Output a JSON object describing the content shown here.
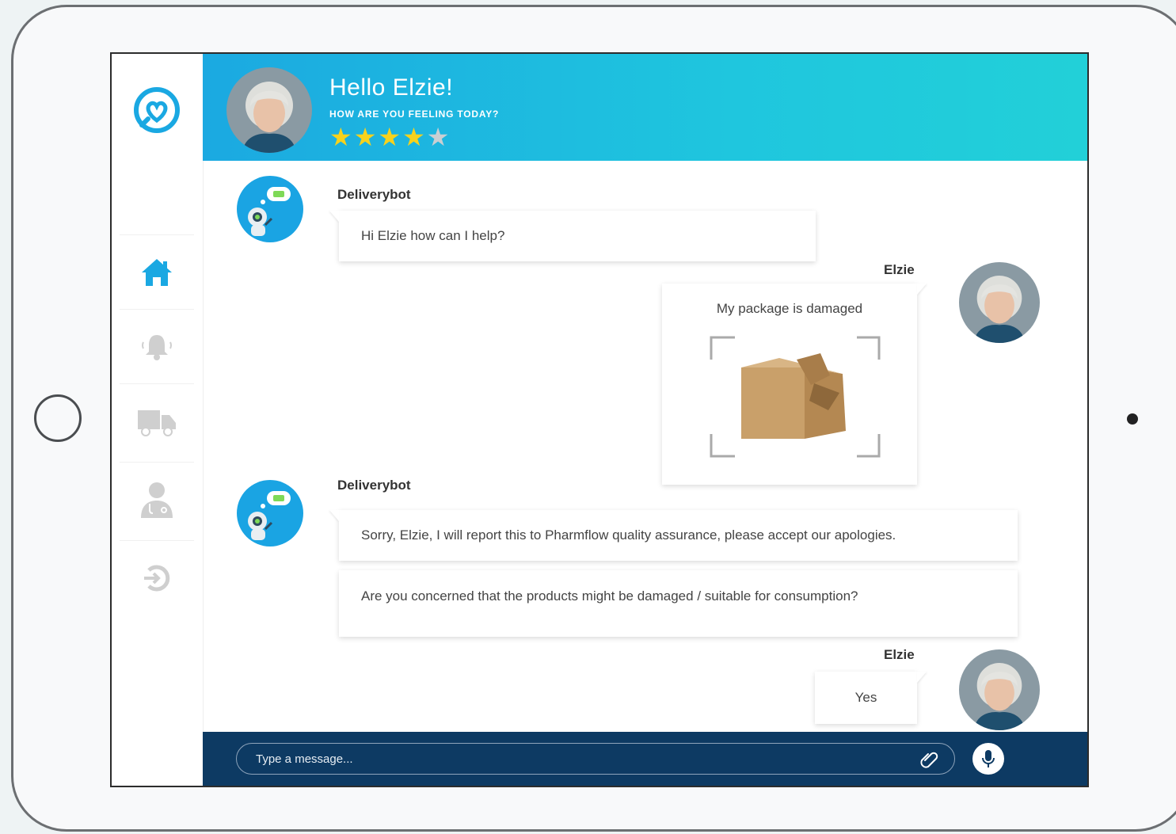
{
  "app": {
    "accent_color": "#1fb6e0",
    "footer_color": "#0d3a63"
  },
  "sidebar": {
    "items": [
      {
        "icon": "home-icon",
        "active": true
      },
      {
        "icon": "bell-icon",
        "active": false
      },
      {
        "icon": "truck-icon",
        "active": false
      },
      {
        "icon": "doctor-icon",
        "active": false
      },
      {
        "icon": "logout-icon",
        "active": false
      }
    ]
  },
  "header": {
    "greeting": "Hello Elzie!",
    "subtitle": "HOW ARE YOU FEELING TODAY?",
    "rating": 4,
    "rating_max": 5
  },
  "messages": [
    {
      "sender": "Deliverybot",
      "text": "Hi Elzie how can I help?"
    },
    {
      "sender": "Elzie",
      "text": "My package is damaged",
      "attachment": "damaged-package-photo"
    },
    {
      "sender": "Deliverybot",
      "text": "Sorry, Elzie, I will report this to Pharmflow quality assurance, please accept our apologies."
    },
    {
      "sender": "Deliverybot",
      "text": "Are you concerned that the products might be damaged / suitable for consumption?"
    },
    {
      "sender": "Elzie",
      "text": "Yes"
    }
  ],
  "composer": {
    "placeholder": "Type a message...",
    "attach_icon": "paperclip-icon",
    "mic_icon": "microphone-icon"
  }
}
